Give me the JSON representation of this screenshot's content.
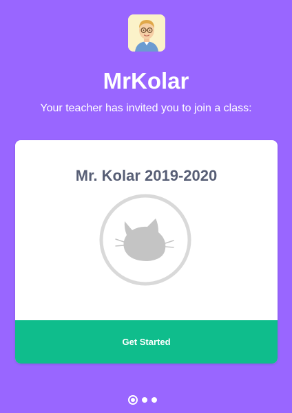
{
  "header": {
    "avatar_icon": "teacher-avatar",
    "teacher_name": "MrKolar",
    "invite_message": "Your teacher has invited you to join a class:"
  },
  "card": {
    "class_title": "Mr. Kolar 2019-2020",
    "thumbnail_icon": "cat-placeholder-icon",
    "button_label": "Get Started"
  },
  "pagination": {
    "total": 3,
    "current": 1
  },
  "colors": {
    "background": "#9966ff",
    "card_background": "#ffffff",
    "title_text": "#575e75",
    "button": "#0fbd8c",
    "placeholder_gray": "#c4c4c4"
  }
}
